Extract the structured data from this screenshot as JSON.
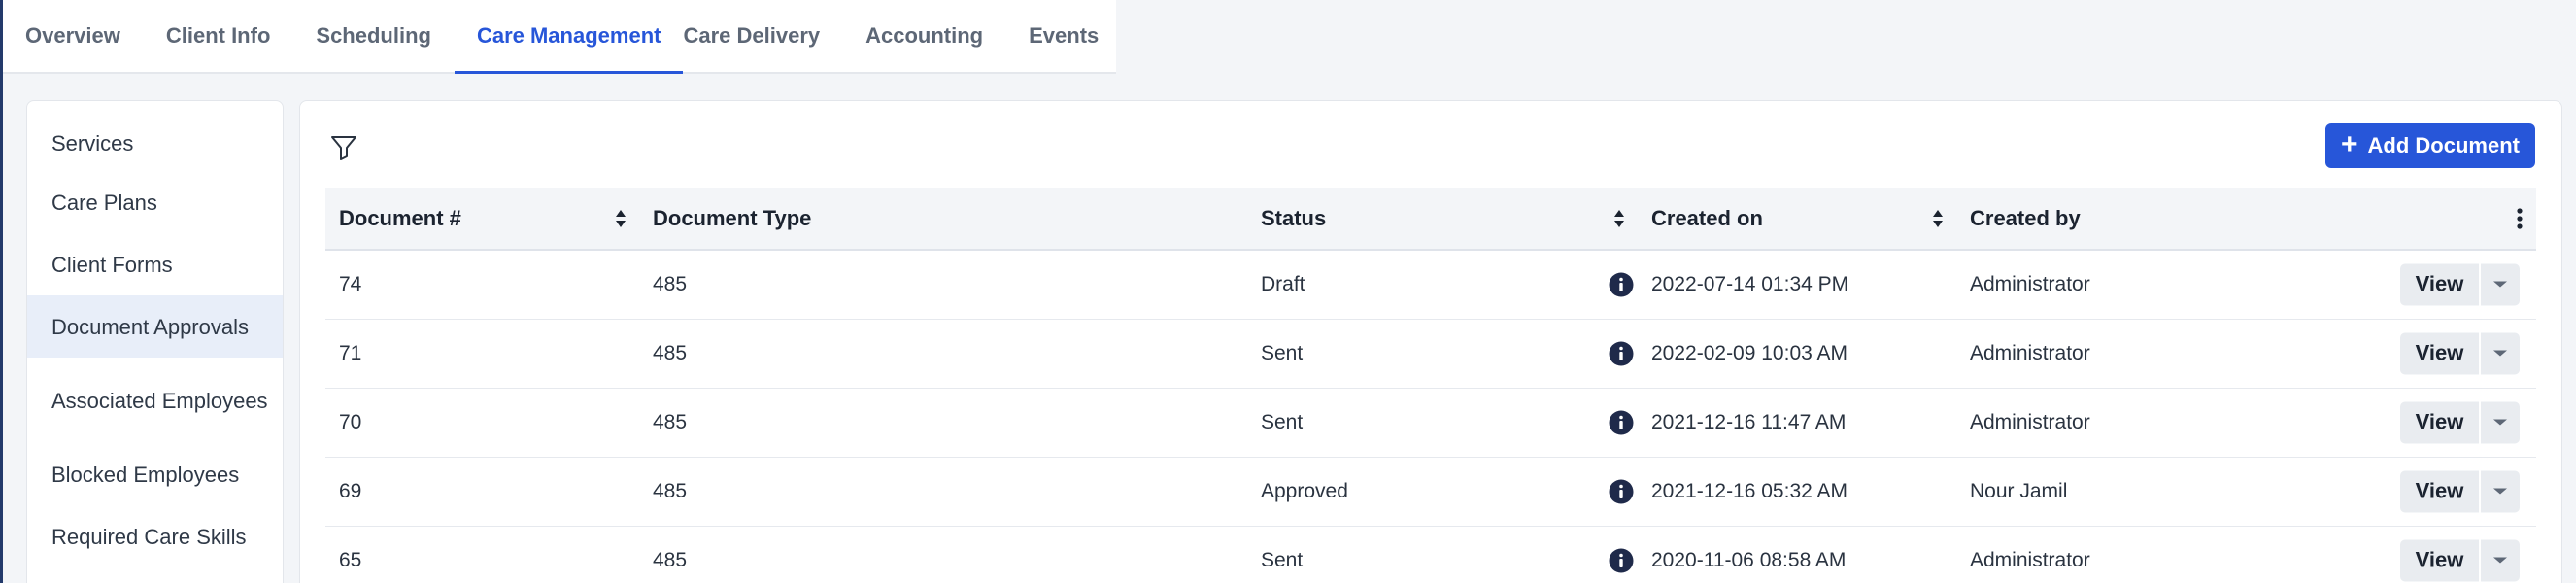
{
  "tabs": [
    {
      "label": "Overview",
      "active": false
    },
    {
      "label": "Client Info",
      "active": false
    },
    {
      "label": "Scheduling",
      "active": false
    },
    {
      "label": "Care Management",
      "active": true
    },
    {
      "label": "Care Delivery",
      "active": false
    },
    {
      "label": "Accounting",
      "active": false
    },
    {
      "label": "Events",
      "active": false
    }
  ],
  "submenu": [
    {
      "label": "Services",
      "active": false
    },
    {
      "label": "Care Plans",
      "active": false
    },
    {
      "label": "Client Forms",
      "active": false
    },
    {
      "label": "Document Approvals",
      "active": true
    },
    {
      "label": "Associated Employees",
      "active": false
    },
    {
      "label": "Blocked Employees",
      "active": false
    },
    {
      "label": "Required Care Skills",
      "active": false
    }
  ],
  "toolbar": {
    "filter_icon": "filter-icon",
    "add_label": "Add Document"
  },
  "table": {
    "columns": {
      "doc_no": "Document #",
      "doc_type": "Document Type",
      "status": "Status",
      "created_on": "Created on",
      "created_by": "Created by"
    },
    "view_label": "View",
    "rows": [
      {
        "doc_no": "74",
        "doc_type": "485",
        "status": "Draft",
        "created_on": "2022-07-14 01:34 PM",
        "created_by": "Administrator"
      },
      {
        "doc_no": "71",
        "doc_type": "485",
        "status": "Sent",
        "created_on": "2022-02-09 10:03 AM",
        "created_by": "Administrator"
      },
      {
        "doc_no": "70",
        "doc_type": "485",
        "status": "Sent",
        "created_on": "2021-12-16 11:47 AM",
        "created_by": "Administrator"
      },
      {
        "doc_no": "69",
        "doc_type": "485",
        "status": "Approved",
        "created_on": "2021-12-16 05:32 AM",
        "created_by": "Nour Jamil"
      },
      {
        "doc_no": "65",
        "doc_type": "485",
        "status": "Sent",
        "created_on": "2020-11-06 08:58 AM",
        "created_by": "Administrator"
      }
    ]
  },
  "colors": {
    "accent": "#2756d9",
    "active_bg": "#e8eef9",
    "info_icon": "#1f2a4a"
  }
}
